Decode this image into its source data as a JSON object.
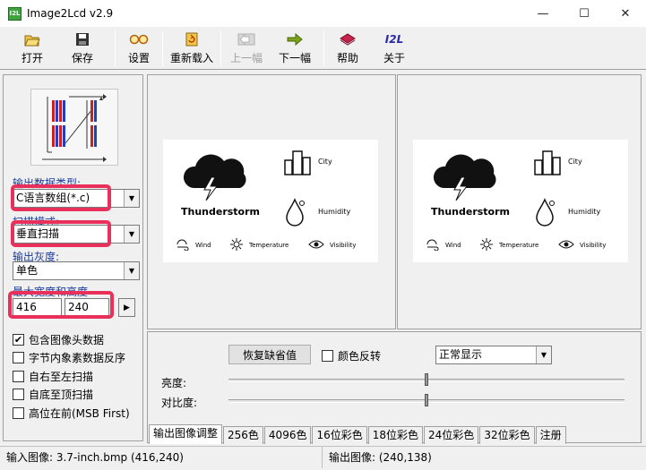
{
  "window": {
    "title": "Image2Lcd v2.9",
    "icon_text": "I2L",
    "controls": [
      "—",
      "☐",
      "✕"
    ]
  },
  "toolbar": [
    {
      "label": "打开",
      "icon": "open-folder-icon",
      "enabled": true
    },
    {
      "label": "保存",
      "icon": "floppy-disk-icon",
      "enabled": true
    },
    {
      "label": "设置",
      "icon": "glasses-icon",
      "enabled": true
    },
    {
      "label": "重新载入",
      "icon": "reload-icon",
      "enabled": true
    },
    {
      "label": "上一幅",
      "icon": "arrow-left-icon",
      "enabled": false
    },
    {
      "label": "下一幅",
      "icon": "arrow-right-icon",
      "enabled": true
    },
    {
      "label": "帮助",
      "icon": "help-book-icon",
      "enabled": true
    },
    {
      "label": "关于",
      "icon": "i2l-logo-icon",
      "icon_text": "I2L",
      "enabled": true
    }
  ],
  "left": {
    "output_type_label": "输出数据类型:",
    "output_type_value": "C语言数组(*.c)",
    "scan_mode_label": "扫描模式:",
    "scan_mode_value": "垂直扫描",
    "gray_label": "输出灰度:",
    "gray_value": "单色",
    "max_size_label": "最大宽度和高度",
    "max_width": "416",
    "max_height": "240",
    "size_button": "▶",
    "checkboxes": [
      {
        "label": "包含图像头数据",
        "checked": true
      },
      {
        "label": "字节内象素数据反序",
        "checked": false
      },
      {
        "label": "自右至左扫描",
        "checked": false
      },
      {
        "label": "自底至顶扫描",
        "checked": false
      },
      {
        "label": "高位在前(MSB First)",
        "checked": false
      }
    ]
  },
  "preview": {
    "main_label": "Thunderstorm",
    "city_label": "City",
    "humidity_label": "Humidity",
    "wind_label": "Wind",
    "temperature_label": "Temperature",
    "visibility_label": "Visibility"
  },
  "settings": {
    "restore_button": "恢复缺省值",
    "invert_label": "颜色反转",
    "invert_checked": false,
    "display_value": "正常显示",
    "brightness_label": "亮度:",
    "contrast_label": "对比度:",
    "brightness_level": 0.5,
    "contrast_level": 0.5,
    "tabs": [
      "输出图像调整",
      "256色",
      "4096色",
      "16位彩色",
      "18位彩色",
      "24位彩色",
      "32位彩色",
      "注册"
    ],
    "active_tab": 0
  },
  "status": {
    "input": "输入图像: 3.7-inch.bmp (416,240)",
    "output": "输出图像: (240,138)"
  },
  "colors": {
    "highlight": "#e8305a",
    "output_label_color": "#1a3a9a"
  }
}
